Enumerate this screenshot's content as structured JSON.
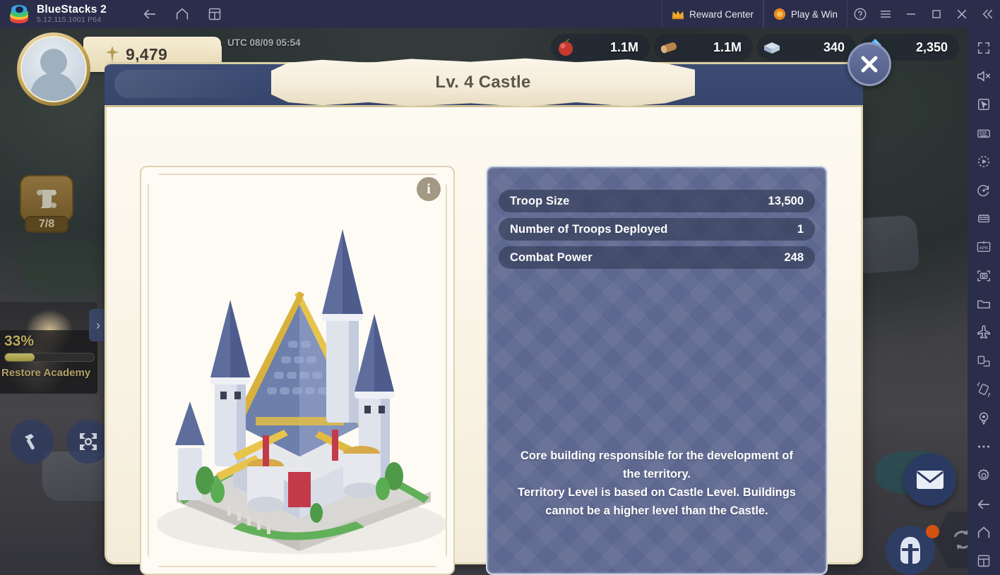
{
  "emulator": {
    "app_name": "BlueStacks 2",
    "version": "5.12.115.1001  P64",
    "nav": [
      {
        "name": "back-button",
        "icon": "arrow-left-icon"
      },
      {
        "name": "home-button",
        "icon": "home-icon"
      },
      {
        "name": "recents-button",
        "icon": "multi-window-icon"
      }
    ],
    "reward_center_label": "Reward Center",
    "play_and_win_label": "Play & Win",
    "window_controls": [
      "help-icon",
      "menu-icon",
      "minimize-icon",
      "maximize-icon",
      "close-icon",
      "collapse-icon"
    ],
    "sidebar_icons": [
      "fullscreen-icon",
      "mute-icon",
      "cursor-icon",
      "keyboard-icon",
      "macro-play-icon",
      "rotate-icon",
      "multi-instance-icon",
      "apk-install-icon",
      "screenshot-icon",
      "folder-icon",
      "airplane-icon",
      "rotate-screen-icon",
      "shake-icon",
      "location-icon",
      "more-icon",
      "settings-icon",
      "android-back-icon",
      "android-home-icon",
      "android-recents-icon"
    ]
  },
  "game_hud": {
    "power_value": "9,479",
    "power_icon": "power-emblem-icon",
    "utc_time": "UTC 08/09 05:54",
    "resources": [
      {
        "name": "food",
        "icon": "food-apple-icon",
        "value": "1.1M",
        "color": "#c7392f"
      },
      {
        "name": "wood",
        "icon": "wood-log-icon",
        "value": "1.1M",
        "color": "#b9844a"
      },
      {
        "name": "stone",
        "icon": "stone-block-icon",
        "value": "340",
        "color": "#aebfd4"
      },
      {
        "name": "gems",
        "icon": "gem-icon",
        "value": "2,350",
        "color": "#3f9ae8"
      }
    ],
    "quest_count": "7/8",
    "quest_icon": "scroll-icon",
    "hero_progress_pct": "33%",
    "hero_progress_value": 33,
    "hero_task_label": "Restore Academy",
    "build_button_icon": "hammer-icon",
    "world_map_button_icon": "world-map-icon",
    "mail_button_icon": "mail-icon",
    "troops_button_icon": "helmet-icon",
    "sync_button_icon": "sync-icon"
  },
  "dialog": {
    "title": "Lv. 4 Castle",
    "close_icon": "close-x-icon",
    "info_icon": "info-icon",
    "building_image": "castle-illustration",
    "stats": [
      {
        "label": "Troop Size",
        "value": "13,500"
      },
      {
        "label": "Number of Troops Deployed",
        "value": "1"
      },
      {
        "label": "Combat Power",
        "value": "248"
      }
    ],
    "description_line1": "Core building responsible for the development of",
    "description_line2": "the territory.",
    "description_line3": "Territory Level is based on Castle Level. Buildings",
    "description_line4": "cannot be a higher level than the Castle."
  },
  "colors": {
    "titlebar": "#2a2e4a",
    "dialog_header": "#3d4c74",
    "banner_cream": "#f7f0de",
    "stats_panel": "#5d678f",
    "stat_row": "#303852",
    "accent_gold": "#d9cfa8"
  }
}
